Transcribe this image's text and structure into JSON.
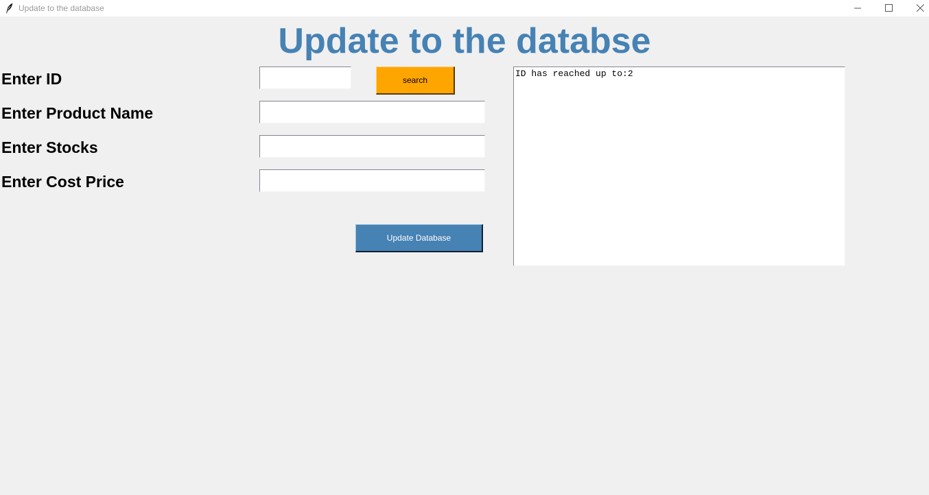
{
  "window": {
    "title": "Update to the database"
  },
  "header": {
    "title": "Update to the databse",
    "title_color": "#4682b4"
  },
  "form": {
    "id_label": "Enter ID",
    "id_value": "",
    "product_name_label": "Enter Product Name",
    "product_name_value": "",
    "stocks_label": "Enter Stocks",
    "stocks_value": "",
    "cost_price_label": "Enter Cost Price",
    "cost_price_value": ""
  },
  "buttons": {
    "search_label": "search",
    "search_color": "#ffa500",
    "update_label": "Update Database",
    "update_color": "#4682b4"
  },
  "output": {
    "text": "ID has reached up to:2"
  },
  "icons": {
    "app": "feather-icon",
    "minimize": "minimize-icon",
    "maximize": "maximize-icon",
    "close": "close-icon"
  }
}
